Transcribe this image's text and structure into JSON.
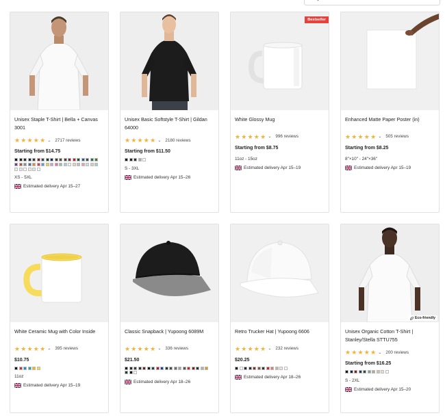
{
  "colors": {
    "star": "#f2b23a",
    "badge": "#e5413d"
  },
  "icons": {
    "search": "magnifier-icon",
    "flag": "uk-flag-icon",
    "chevron": "chevron-down-icon",
    "leaf": "leaf-icon"
  },
  "products": [
    {
      "title": "Unisex Staple T-Shirt | Bella + Canvas 3001",
      "stars": 4.5,
      "reviews": "2717 reviews",
      "price": "Starting from $14.75",
      "swatches": [
        "#111111",
        "#222222",
        "#2d2d2d",
        "#1c2a44",
        "#3b3b3b",
        "#8b1a1a",
        "#444444",
        "#1f3a2e",
        "#0f2f5a",
        "#3a3a3a",
        "#5a4636",
        "#394a26",
        "#7a2f45",
        "#b4223a",
        "#1e4f3c",
        "#2d5b8c",
        "#4a4a4a",
        "#1f6e5e",
        "#5d6b2e",
        "#6d3b8d",
        "#c64e2c",
        "#8c8c8c",
        "#3f6fb0",
        "#e0892e",
        "#d33c4a",
        "#5a9ad6",
        "#f4c93b",
        "#c7a0c9",
        "#e96fa3",
        "#8fc4a0",
        "#a7c7e7",
        "#f2f2e6",
        "#e6d3b3",
        "#bfbfbf",
        "#f29aa7",
        "#c4e1e9",
        "#d8cfb9",
        "#9fd3c7",
        "#f1efe4",
        "#e7e7e7",
        "#ffffff",
        "#f4f0da",
        "#d8e9f3",
        "#ffffff"
      ],
      "size": "XS - 5XL",
      "delivery": "Estimated delivery Apr 15–27"
    },
    {
      "title": "Unisex Basic Softstyle T-Shirt | Gildan 64000",
      "stars": 4.5,
      "reviews": "2180 reviews",
      "price": "Starting from $11.50",
      "swatches": [
        "#111111",
        "#1b2340",
        "#2e2e2e",
        "#a9a9a9",
        "#ffffff"
      ],
      "size": "S - 3XL",
      "delivery": "Estimated delivery Apr 15–26"
    },
    {
      "title": "White Glossy Mug",
      "stars": 4.5,
      "reviews": "996 reviews",
      "price": "Starting from $8.75",
      "swatches": [],
      "size": "11oz - 15oz",
      "delivery": "Estimated delivery Apr 15–19",
      "badge": "Bestseller"
    },
    {
      "title": "Enhanced Matte Paper Poster (in)",
      "stars": 4.5,
      "reviews": "505 reviews",
      "price": "Starting from $8.25",
      "swatches": [],
      "size": "8″×10″ - 24″×36″",
      "delivery": "Estimated delivery Apr 15–19"
    },
    {
      "title": "White Ceramic Mug with Color Inside",
      "stars": 4.5,
      "reviews": "395 reviews",
      "price": "$10.75",
      "swatches": [
        "#111111",
        "#d32f2f",
        "#1e88e5",
        "#26a69a",
        "#ffb300",
        "#fdd835"
      ],
      "size": "11oz",
      "delivery": "Estimated delivery Apr 15–19"
    },
    {
      "title": "Classic Snapback | Yupoong 6089M",
      "stars": 4.5,
      "reviews": "336 reviews",
      "price": "$21.50",
      "swatches": [
        "#111111",
        "#1b2a40",
        "#3a3a3a",
        "#2e2e2e",
        "#6b1d2b",
        "#1a1a1a",
        "#2a3b5a",
        "#b71c1c",
        "#0d47a1",
        "#263238",
        "#4a4a4a",
        "#6d6d6d",
        "#9e9e9e",
        "#555555",
        "#c62828",
        "#7a1f1f",
        "#2b2b2b",
        "#b0b0b0",
        "#d4a017",
        "#1f3a2e",
        "#0a0a0a",
        "#ffffff"
      ],
      "size": "",
      "delivery": "Estimated delivery Apr 18–26"
    },
    {
      "title": "Retro Trucker Hat | Yupoong 6606",
      "stars": 4.5,
      "reviews": "232 reviews",
      "price": "$20.25",
      "swatches": [
        "#111111",
        "#ffffff",
        "#1b2a40",
        "#2e2e2e",
        "#8d2330",
        "#7a5a3a",
        "#333333",
        "#c62828",
        "#d87a7a",
        "#c9b79c",
        "#e5e5e5",
        "#ffffff"
      ],
      "size": "",
      "delivery": "Estimated delivery Apr 18–26"
    },
    {
      "title": "Unisex Organic Cotton T-Shirt | Stanley/Stella STTU755",
      "stars": 4.5,
      "reviews": "200 reviews",
      "price": "Starting from $16.25",
      "swatches": [
        "#111111",
        "#1b2340",
        "#8b1a1a",
        "#23395b",
        "#2e4a3b",
        "#8a9a8a",
        "#b9a58a",
        "#c8c2b6",
        "#e6e0d4",
        "#ffffff"
      ],
      "size": "S - 2XL",
      "delivery": "Estimated delivery Apr 15–20",
      "eco": "Eco-friendly"
    }
  ]
}
